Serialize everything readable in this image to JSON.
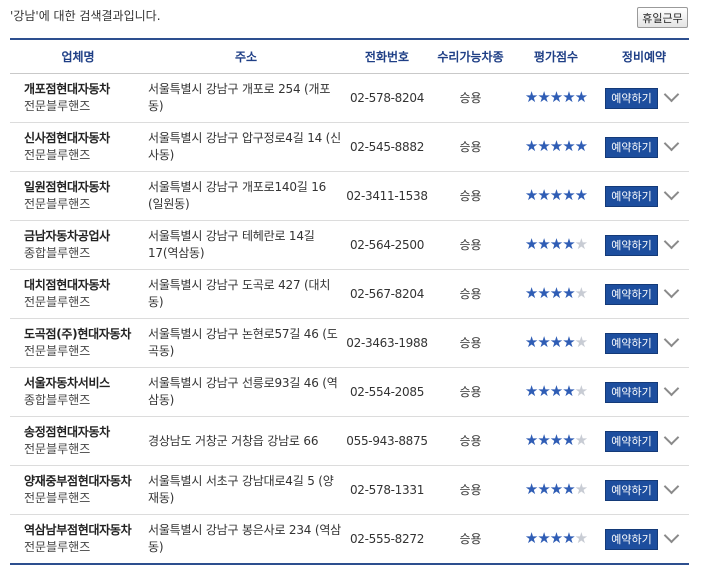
{
  "search": {
    "keyword_quoted": "'강남'",
    "message_suffix": "에 대한 검색결과입니다."
  },
  "holiday_button": "휴일근무",
  "table": {
    "columns": [
      "업체명",
      "주소",
      "전화번호",
      "수리가능차종",
      "평가점수",
      "정비예약"
    ],
    "book_label": "예약하기",
    "star_color_on": "#2f5db5",
    "star_color_off": "#c8ccd4",
    "rows": [
      {
        "name": "개포점현대자동차",
        "type": "전문블루핸즈",
        "address": "서울특별시 강남구 개포로 254 (개포동)",
        "phone": "02-578-8204",
        "car": "승용",
        "rating": 5
      },
      {
        "name": "신사점현대자동차",
        "type": "전문블루핸즈",
        "address": "서울특별시 강남구 압구정로4길 14 (신사동)",
        "phone": "02-545-8882",
        "car": "승용",
        "rating": 5
      },
      {
        "name": "일원점현대자동차",
        "type": "전문블루핸즈",
        "address": "서울특별시 강남구 개포로140길 16 (일원동)",
        "phone": "02-3411-1538",
        "car": "승용",
        "rating": 5
      },
      {
        "name": "금남자동차공업사",
        "type": "종합블루핸즈",
        "address": "서울특별시 강남구 테헤란로 14길 17(역삼동)",
        "phone": "02-564-2500",
        "car": "승용",
        "rating": 4
      },
      {
        "name": "대치점현대자동차",
        "type": "전문블루핸즈",
        "address": "서울특별시 강남구 도곡로 427 (대치동)",
        "phone": "02-567-8204",
        "car": "승용",
        "rating": 4
      },
      {
        "name": "도곡점(주)현대자동차",
        "type": "전문블루핸즈",
        "address": "서울특별시 강남구 논현로57길 46 (도곡동)",
        "phone": "02-3463-1988",
        "car": "승용",
        "rating": 4
      },
      {
        "name": "서울자동차서비스",
        "type": "종합블루핸즈",
        "address": "서울특별시 강남구 선릉로93길 46 (역삼동)",
        "phone": "02-554-2085",
        "car": "승용",
        "rating": 4
      },
      {
        "name": "송정점현대자동차",
        "type": "전문블루핸즈",
        "address": "경상남도 거창군 거창읍 강남로 66",
        "phone": "055-943-8875",
        "car": "승용",
        "rating": 4
      },
      {
        "name": "양재중부점현대자동차",
        "type": "전문블루핸즈",
        "address": "서울특별시 서초구 강남대로4길 5 (양재동)",
        "phone": "02-578-1331",
        "car": "승용",
        "rating": 4
      },
      {
        "name": "역삼남부점현대자동차",
        "type": "전문블루핸즈",
        "address": "서울특별시 강남구 봉은사로 234 (역삼동)",
        "phone": "02-555-8272",
        "car": "승용",
        "rating": 4
      }
    ]
  }
}
